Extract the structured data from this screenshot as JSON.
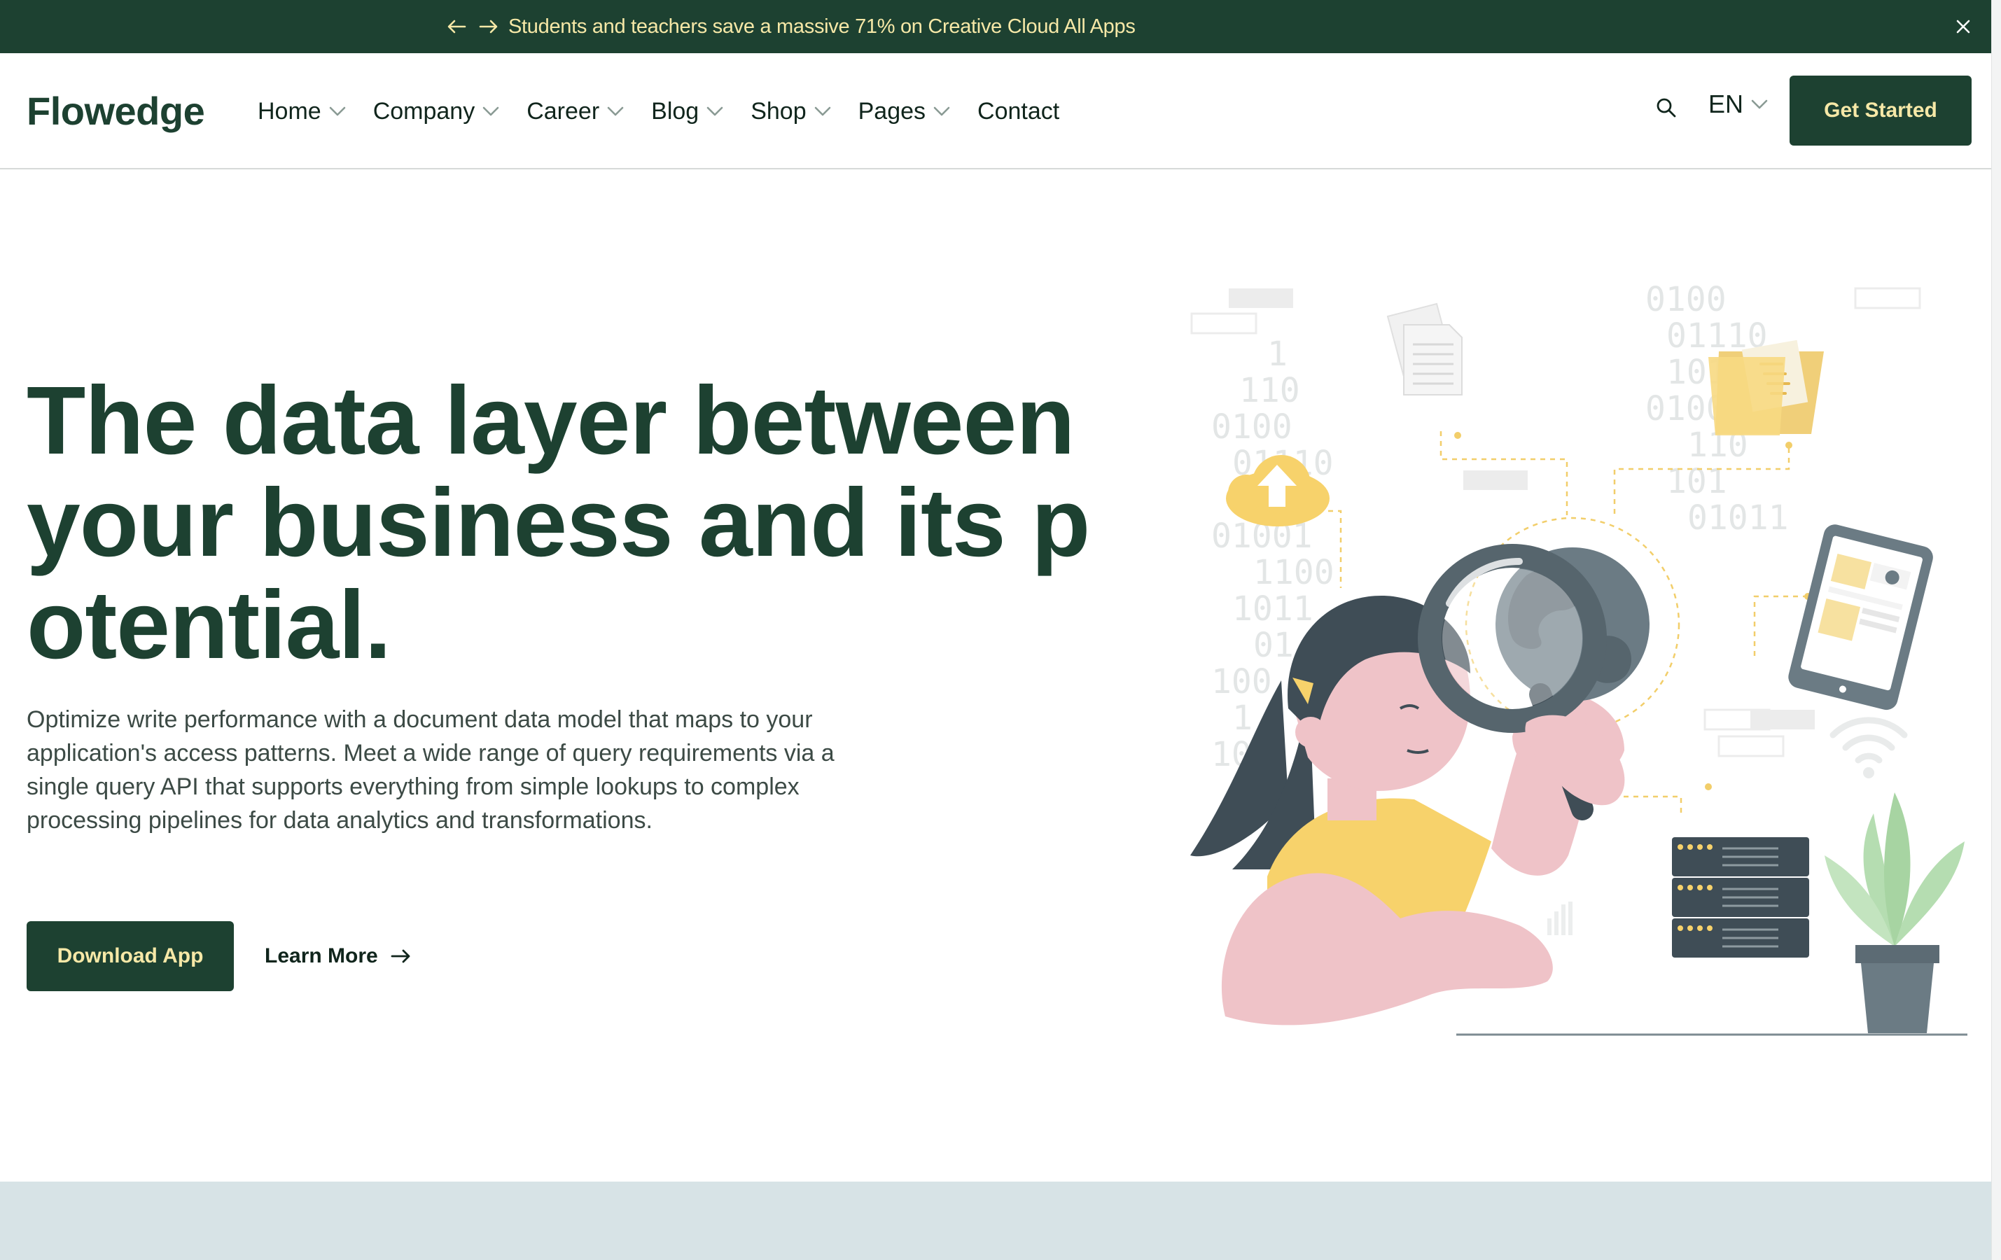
{
  "announcement": {
    "message": "Students and teachers save a massive 71% on Creative Cloud All Apps",
    "prev_icon": "arrow-left-icon",
    "next_icon": "arrow-right-icon",
    "close_icon": "close-icon"
  },
  "header": {
    "logo": "Flowedge",
    "nav": [
      {
        "label": "Home",
        "has_dropdown": true
      },
      {
        "label": "Company",
        "has_dropdown": true
      },
      {
        "label": "Career",
        "has_dropdown": true
      },
      {
        "label": "Blog",
        "has_dropdown": true
      },
      {
        "label": "Shop",
        "has_dropdown": true
      },
      {
        "label": "Pages",
        "has_dropdown": true
      },
      {
        "label": "Contact",
        "has_dropdown": false
      }
    ],
    "search_icon": "search-icon",
    "language": "EN",
    "cta_label": "Get Started"
  },
  "hero": {
    "title": "The data layer between your business and its potential.",
    "description": "Optimize write performance with a document data model that maps to your application's access patterns. Meet a wide range of query requirements via a single query API that supports everything from simple lookups to complex processing pipelines for data analytics and transformations.",
    "primary_button": "Download App",
    "secondary_link": "Learn More",
    "illustration": "person-with-magnifying-glass-data-illustration"
  },
  "colors": {
    "brand_dark": "#1d4131",
    "brand_accent_text": "#f6e8a7",
    "illustration_yellow": "#f7d26b",
    "illustration_pink": "#efc3c8",
    "band": "#d7e3e6"
  }
}
